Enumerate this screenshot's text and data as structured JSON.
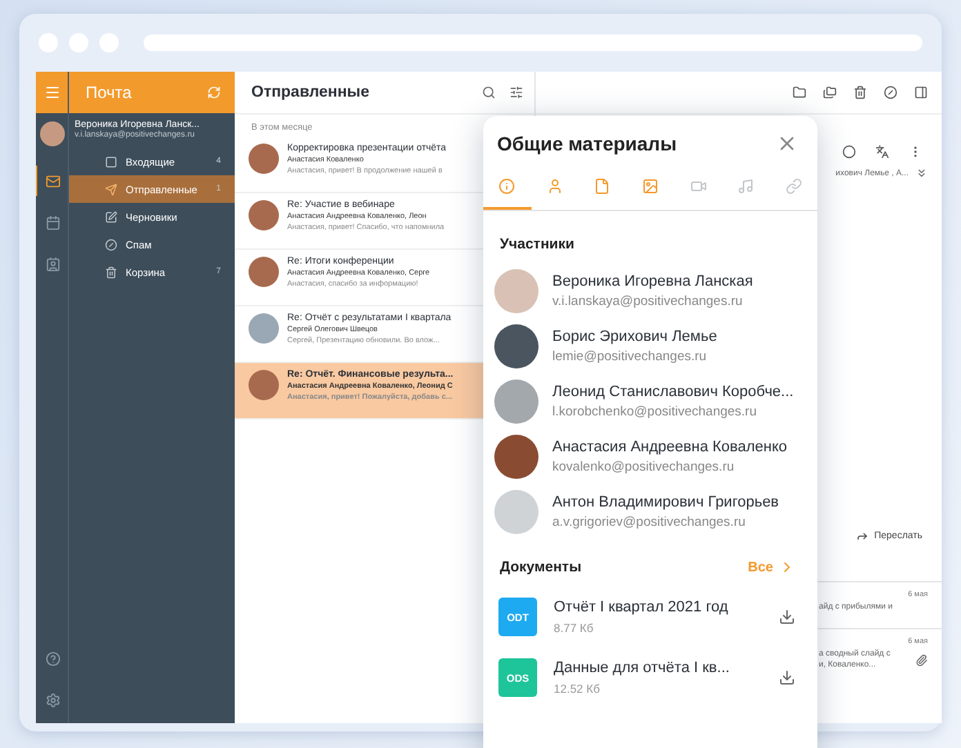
{
  "app": {
    "title": "Почта"
  },
  "account": {
    "name": "Вероника Игоревна Ланск...",
    "email": "v.i.lanskaya@positivechanges.ru"
  },
  "rail": [
    {
      "kind": "mail",
      "selected": true
    },
    {
      "kind": "calendar",
      "selected": false
    },
    {
      "kind": "contacts",
      "selected": false
    }
  ],
  "folders": [
    {
      "kind": "inbox",
      "label": "Входящие",
      "count": "4",
      "selected": false
    },
    {
      "kind": "sent",
      "label": "Отправленные",
      "count": "1",
      "selected": true
    },
    {
      "kind": "drafts",
      "label": "Черновики",
      "selected": false
    },
    {
      "kind": "spam",
      "label": "Спам",
      "selected": false
    },
    {
      "kind": "trash",
      "label": "Корзина",
      "count": "7",
      "selected": false
    }
  ],
  "list": {
    "title": "Отправленные",
    "group": "В этом месяце",
    "messages": [
      {
        "subject": "Корректировка презентации отчёта",
        "from": "Анастасия Коваленко",
        "preview": "Анастасия, привет! В продолжение нашей в",
        "selected": false
      },
      {
        "subject": "Re: Участие в вебинаре",
        "from": "Анастасия Андреевна Коваленко, Леон",
        "preview": "Анастасия, привет! Спасибо, что напомнила",
        "selected": false
      },
      {
        "subject": "Re: Итоги конференции",
        "from": "Анастасия Андреевна Коваленко, Серге",
        "preview": "Анастасия, спасибо за информацию!",
        "selected": false
      },
      {
        "subject": "Re: Отчёт с результатами I квартала",
        "from": "Сергей Олегович Швецов",
        "preview": "Сергей, Презентацию обновили. Во влож...",
        "selected": false
      },
      {
        "subject": "Re: Отчёт. Финансовые результа...",
        "from": "Анастасия Андреевна Коваленко, Леонид С",
        "preview": "Анастасия, привет! Пожалуйста, добавь с...",
        "selected": true
      }
    ]
  },
  "reading": {
    "recipients": "ихович Лемье , А...",
    "forward": "Переслать",
    "thread": [
      {
        "date": "6 мая",
        "preview": "айд с прибылями и",
        "attachment": false
      },
      {
        "date": "6 мая",
        "preview": "а сводный слайд с",
        "preview_2": "и, Коваленко...",
        "attachment": true
      }
    ]
  },
  "dialog": {
    "title": "Общие материалы",
    "tabs": [
      {
        "kind": "info",
        "selected": true,
        "disabled": false
      },
      {
        "kind": "people",
        "selected": false,
        "disabled": false
      },
      {
        "kind": "files",
        "selected": false,
        "disabled": false
      },
      {
        "kind": "images",
        "selected": false,
        "disabled": false
      },
      {
        "kind": "video",
        "selected": false,
        "disabled": true
      },
      {
        "kind": "audio",
        "selected": false,
        "disabled": true
      },
      {
        "kind": "links",
        "selected": false,
        "disabled": true
      }
    ],
    "participants_title": "Участники",
    "participants": [
      {
        "name": "Вероника Игоревна Ланская",
        "email": "v.i.lanskaya@positivechanges.ru"
      },
      {
        "name": "Борис Эрихович Лемье",
        "email": "lemie@positivechanges.ru"
      },
      {
        "name": "Леонид Станиславович Коробче...",
        "email": "l.korobchenko@positivechanges.ru"
      },
      {
        "name": "Анастасия Андреевна Коваленко",
        "email": "kovalenko@positivechanges.ru"
      },
      {
        "name": "Антон Владимирович Григорьев",
        "email": "a.v.grigoriev@positivechanges.ru"
      }
    ],
    "documents_title": "Документы",
    "documents_all": "Все",
    "documents": [
      {
        "type": "ODT",
        "color": "#1eaaf1",
        "name": "Отчёт I квартал 2021 год",
        "size": "8.77 Кб"
      },
      {
        "type": "ODS",
        "color": "#1ec49a",
        "name": "Данные для отчёта I кв...",
        "size": "12.52 Кб"
      }
    ]
  }
}
